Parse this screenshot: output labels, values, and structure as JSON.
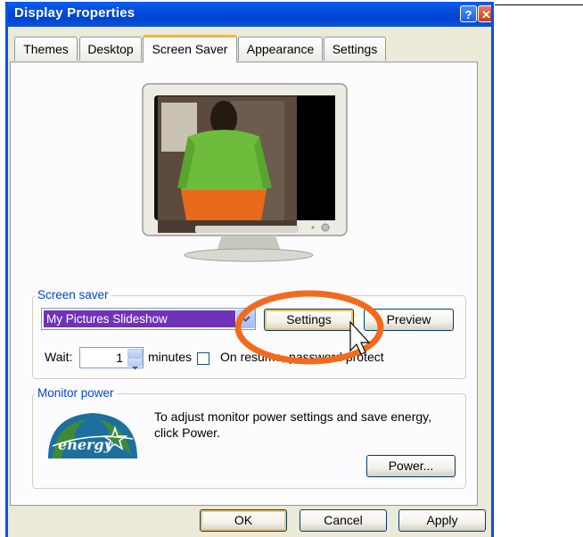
{
  "window": {
    "title": "Display Properties",
    "help_glyph": "?",
    "close_glyph": "✕"
  },
  "tabs": [
    {
      "label": "Themes"
    },
    {
      "label": "Desktop"
    },
    {
      "label": "Screen Saver"
    },
    {
      "label": "Appearance"
    },
    {
      "label": "Settings"
    }
  ],
  "active_tab": "Screen Saver",
  "screen_saver": {
    "group_label": "Screen saver",
    "selected": "My Pictures Slideshow",
    "settings_button": "Settings",
    "preview_button": "Preview",
    "wait_label": "Wait:",
    "wait_value": "1",
    "minutes_label": "minutes",
    "resume_label": "On resume, password protect",
    "resume_checked": false
  },
  "monitor_power": {
    "group_label": "Monitor power",
    "description": "To adjust monitor power settings and save energy, click Power.",
    "power_button": "Power...",
    "logo_text": "energy"
  },
  "footer": {
    "ok": "OK",
    "cancel": "Cancel",
    "apply": "Apply"
  },
  "annotation": {
    "highlight_color": "#f26b1d"
  },
  "colors": {
    "titlebar": "#0348d6",
    "selection": "#6f33b8",
    "group_label": "#0046d5"
  }
}
